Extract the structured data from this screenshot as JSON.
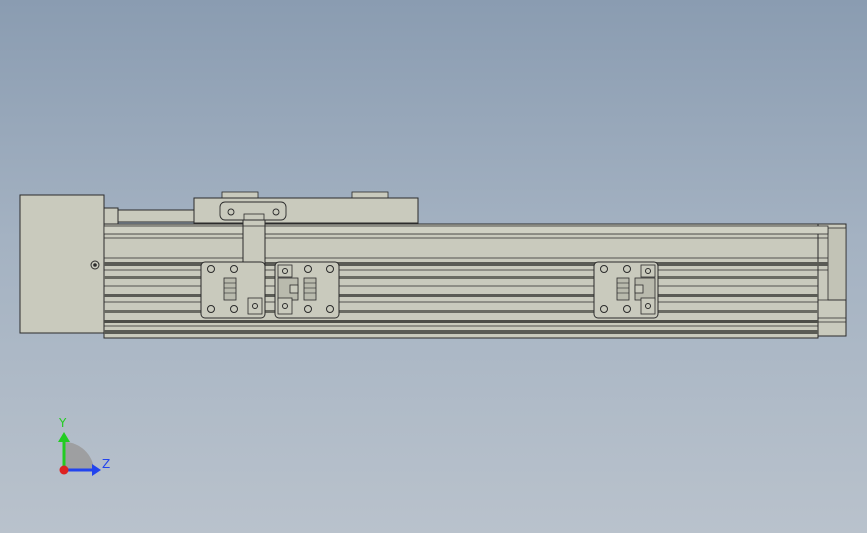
{
  "viewport": {
    "background_top": "#8a9cb1",
    "background_bottom": "#b9c2cc",
    "model_fill": "#c9cabd",
    "model_edge": "#2b2b2b"
  },
  "triad": {
    "y_label": "Y",
    "z_label": "Z",
    "y_color": "#22cc22",
    "z_color": "#2244ee",
    "x_color": "#dd2222"
  },
  "model": {
    "parts": [
      "motor-block",
      "rail-profile",
      "carriage",
      "clamp-arm",
      "mounting-bracket"
    ]
  }
}
